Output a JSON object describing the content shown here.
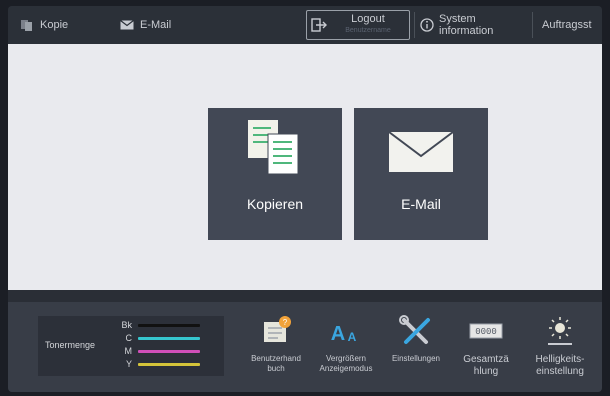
{
  "topbar": {
    "kopie": "Kopie",
    "email": "E-Mail",
    "logout": "Logout",
    "logout_sub": "Benutzername",
    "system_line1": "System",
    "system_line2": "information",
    "auftragsstatus": "Auftragsst"
  },
  "tiles": {
    "copy_label": "Kopieren",
    "mail_label": "E-Mail"
  },
  "toner": {
    "label": "Tonermenge",
    "channels": [
      {
        "name": "Bk",
        "color": "#111111"
      },
      {
        "name": "C",
        "color": "#36c6cf"
      },
      {
        "name": "M",
        "color": "#d04fb9"
      },
      {
        "name": "Y",
        "color": "#d4c43a"
      }
    ]
  },
  "bottom_buttons": {
    "handbuch": [
      "Benutzerhand",
      "buch"
    ],
    "vergroessern": [
      "Vergrößern",
      "Anzeigemodus"
    ],
    "einstellungen": [
      "Einstellungen"
    ],
    "gesamtzaehlung": [
      "Gesamtzä",
      "hlung"
    ],
    "helligkeit": [
      "Helligkeits-",
      "einstellung"
    ],
    "counter_display": "0000"
  },
  "colors": {
    "accent_green": "#4fb77c",
    "accent_blue": "#3aa6e0",
    "badge_orange": "#f2a33a"
  }
}
